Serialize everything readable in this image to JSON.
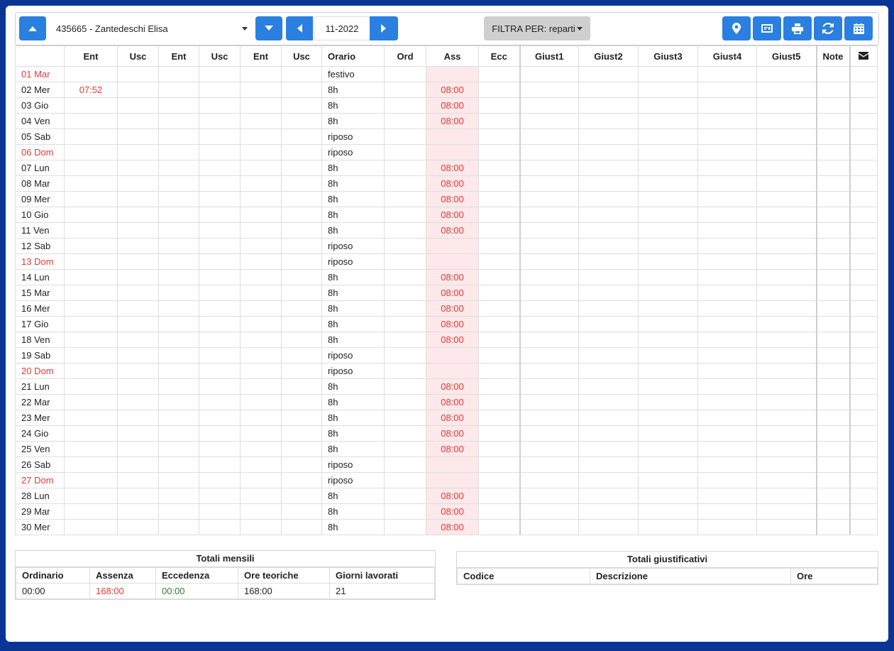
{
  "employee": {
    "selected": "435665 - Zantedeschi Elisa"
  },
  "period": {
    "month": "11-2022"
  },
  "filter": {
    "label": "FILTRA PER: reparti"
  },
  "table": {
    "headers": [
      "",
      "Ent",
      "Usc",
      "Ent",
      "Usc",
      "Ent",
      "Usc",
      "Orario",
      "Ord",
      "Ass",
      "Ecc",
      "Giust1",
      "Giust2",
      "Giust3",
      "Giust4",
      "Giust5",
      "Note",
      ""
    ],
    "rows": [
      {
        "day": "01 Mar",
        "holiday": true,
        "ent1": "",
        "orario": "festivo",
        "ass": ""
      },
      {
        "day": "02 Mer",
        "holiday": false,
        "ent1": "07:52",
        "orario": "8h",
        "ass": "08:00"
      },
      {
        "day": "03 Gio",
        "holiday": false,
        "ent1": "",
        "orario": "8h",
        "ass": "08:00"
      },
      {
        "day": "04 Ven",
        "holiday": false,
        "ent1": "",
        "orario": "8h",
        "ass": "08:00"
      },
      {
        "day": "05 Sab",
        "holiday": false,
        "ent1": "",
        "orario": "riposo",
        "ass": ""
      },
      {
        "day": "06 Dom",
        "holiday": true,
        "ent1": "",
        "orario": "riposo",
        "ass": ""
      },
      {
        "day": "07 Lun",
        "holiday": false,
        "ent1": "",
        "orario": "8h",
        "ass": "08:00"
      },
      {
        "day": "08 Mar",
        "holiday": false,
        "ent1": "",
        "orario": "8h",
        "ass": "08:00"
      },
      {
        "day": "09 Mer",
        "holiday": false,
        "ent1": "",
        "orario": "8h",
        "ass": "08:00"
      },
      {
        "day": "10 Gio",
        "holiday": false,
        "ent1": "",
        "orario": "8h",
        "ass": "08:00"
      },
      {
        "day": "11 Ven",
        "holiday": false,
        "ent1": "",
        "orario": "8h",
        "ass": "08:00"
      },
      {
        "day": "12 Sab",
        "holiday": false,
        "ent1": "",
        "orario": "riposo",
        "ass": ""
      },
      {
        "day": "13 Dom",
        "holiday": true,
        "ent1": "",
        "orario": "riposo",
        "ass": ""
      },
      {
        "day": "14 Lun",
        "holiday": false,
        "ent1": "",
        "orario": "8h",
        "ass": "08:00"
      },
      {
        "day": "15 Mar",
        "holiday": false,
        "ent1": "",
        "orario": "8h",
        "ass": "08:00"
      },
      {
        "day": "16 Mer",
        "holiday": false,
        "ent1": "",
        "orario": "8h",
        "ass": "08:00"
      },
      {
        "day": "17 Gio",
        "holiday": false,
        "ent1": "",
        "orario": "8h",
        "ass": "08:00"
      },
      {
        "day": "18 Ven",
        "holiday": false,
        "ent1": "",
        "orario": "8h",
        "ass": "08:00"
      },
      {
        "day": "19 Sab",
        "holiday": false,
        "ent1": "",
        "orario": "riposo",
        "ass": ""
      },
      {
        "day": "20 Dom",
        "holiday": true,
        "ent1": "",
        "orario": "riposo",
        "ass": ""
      },
      {
        "day": "21 Lun",
        "holiday": false,
        "ent1": "",
        "orario": "8h",
        "ass": "08:00"
      },
      {
        "day": "22 Mar",
        "holiday": false,
        "ent1": "",
        "orario": "8h",
        "ass": "08:00"
      },
      {
        "day": "23 Mer",
        "holiday": false,
        "ent1": "",
        "orario": "8h",
        "ass": "08:00"
      },
      {
        "day": "24 Gio",
        "holiday": false,
        "ent1": "",
        "orario": "8h",
        "ass": "08:00"
      },
      {
        "day": "25 Ven",
        "holiday": false,
        "ent1": "",
        "orario": "8h",
        "ass": "08:00"
      },
      {
        "day": "26 Sab",
        "holiday": false,
        "ent1": "",
        "orario": "riposo",
        "ass": ""
      },
      {
        "day": "27 Dom",
        "holiday": true,
        "ent1": "",
        "orario": "riposo",
        "ass": ""
      },
      {
        "day": "28 Lun",
        "holiday": false,
        "ent1": "",
        "orario": "8h",
        "ass": "08:00"
      },
      {
        "day": "29 Mar",
        "holiday": false,
        "ent1": "",
        "orario": "8h",
        "ass": "08:00"
      },
      {
        "day": "30 Mer",
        "holiday": false,
        "ent1": "",
        "orario": "8h",
        "ass": "08:00"
      }
    ]
  },
  "totali_mensili": {
    "title": "Totali mensili",
    "headers": [
      "Ordinario",
      "Assenza",
      "Eccedenza",
      "Ore teoriche",
      "Giorni lavorati"
    ],
    "values": [
      "00:00",
      "168:00",
      "00:00",
      "168:00",
      "21"
    ]
  },
  "totali_giustificativi": {
    "title": "Totali giustificativi",
    "headers": [
      "Codice",
      "Descrizione",
      "Ore"
    ]
  },
  "colors": {
    "brand": "#2a7fe0",
    "frame": "#0a3595",
    "absence_bg": "#fde8ea",
    "alert": "#e53935",
    "ok": "#2e7d32"
  }
}
